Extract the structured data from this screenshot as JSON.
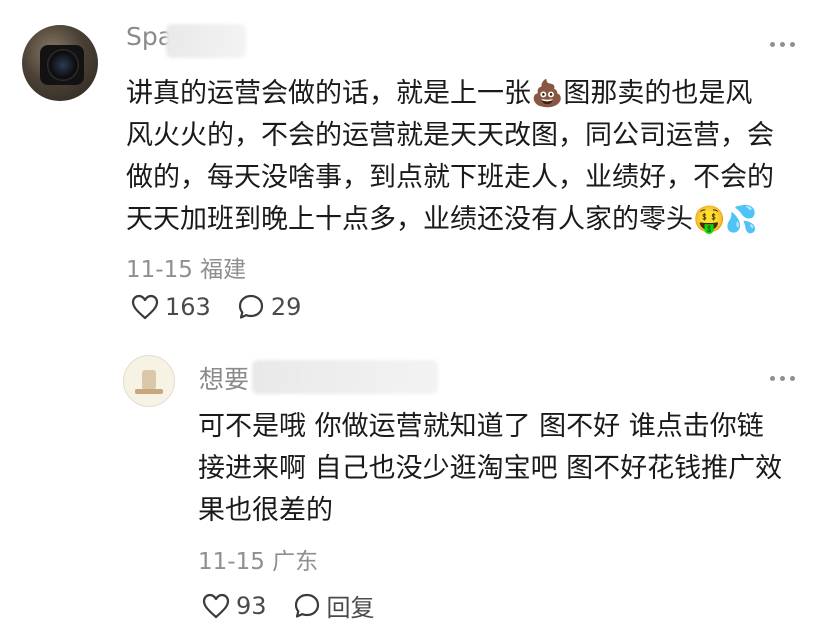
{
  "comment": {
    "username_visible": "Spa",
    "lines": [
      "讲真的运营会做的话，就是上一张",
      "风火火的，不会的运营就是天天改图，同公司运营，会",
      "做的，每天没啥事，到点就下班走人，业绩好，不会的",
      "天天加班到晚上十点多，业绩还没有人家的零头"
    ],
    "line1_after_emoji": "图那卖的也是风",
    "emoji_poop": "💩",
    "emoji_end": "🤑",
    "emoji_sweat": "💦",
    "date": "11-15",
    "location": "福建",
    "likes": "163",
    "replies": "29"
  },
  "reply": {
    "username_visible": "想要",
    "lines": [
      "可不是哦 你做运营就知道了 图不好 谁点击你链",
      "接进来啊 自己也没少逛淘宝吧 图不好花钱推广效",
      "果也很差的"
    ],
    "date": "11-15",
    "location": "广东",
    "likes": "93",
    "reply_label": "回复"
  },
  "icons": [
    "heart-icon",
    "comment-icon",
    "more-options-icon"
  ]
}
